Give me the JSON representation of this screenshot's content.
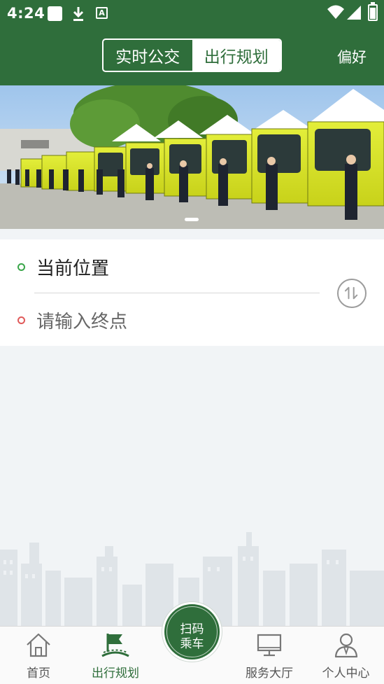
{
  "status_bar": {
    "time": "4:24",
    "icons": [
      "notification-square-icon",
      "download-icon",
      "a-icon",
      "wifi-icon",
      "signal-icon",
      "battery-icon"
    ]
  },
  "app_bar": {
    "tabs": [
      {
        "label": "实时公交",
        "active": false
      },
      {
        "label": "出行规划",
        "active": true
      }
    ],
    "preferences_label": "偏好"
  },
  "banner": {
    "image": "bus-fleet-with-staff-photo",
    "page_indicator": {
      "count": 1,
      "active": 0
    }
  },
  "route_planner": {
    "start_text": "当前位置",
    "end_placeholder": "请输入终点",
    "swap_icon": "swap-icon"
  },
  "scan_button": {
    "line1": "扫码",
    "line2": "乘车"
  },
  "bottom_nav": {
    "items": [
      {
        "label": "首页",
        "icon": "home-icon",
        "active": false
      },
      {
        "label": "出行规划",
        "icon": "flag-icon",
        "active": true
      },
      {
        "label": "服务大厅",
        "icon": "monitor-icon",
        "active": false
      },
      {
        "label": "个人中心",
        "icon": "person-icon",
        "active": false
      }
    ]
  },
  "colors": {
    "brand": "#2f6e3b",
    "start_ring": "#3aa64a",
    "end_ring": "#e05a5a",
    "background": "#f1f4f6"
  }
}
